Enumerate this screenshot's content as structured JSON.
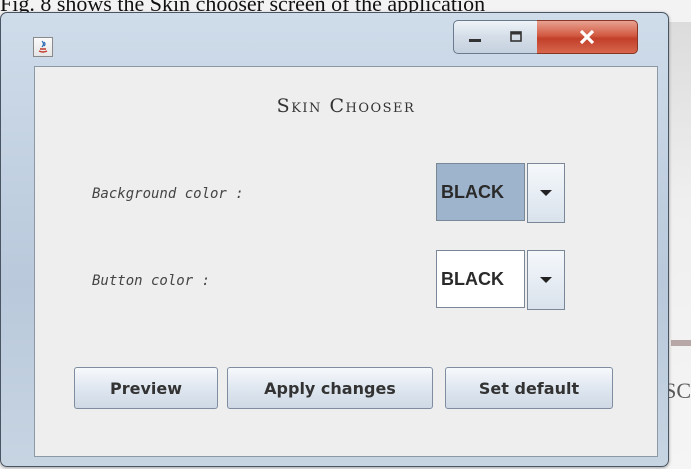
{
  "caption": "Fig. 8 shows the Skin chooser screen of the application",
  "background": {
    "partial_text": "SC"
  },
  "window": {
    "title": "",
    "controls": {
      "minimize": "minimize",
      "maximize": "maximize",
      "close": "close"
    }
  },
  "dialog": {
    "title": "Skin Chooser",
    "background_label": "Background color :",
    "background_value": "BLACK",
    "button_label": "Button color :",
    "button_value": "BLACK",
    "buttons": {
      "preview": "Preview",
      "apply": "Apply changes",
      "default": "Set default"
    }
  },
  "colors": {
    "selection": "#9eb4cc",
    "close_button": "#c9462f",
    "window_frame": "#c4d2e1"
  }
}
